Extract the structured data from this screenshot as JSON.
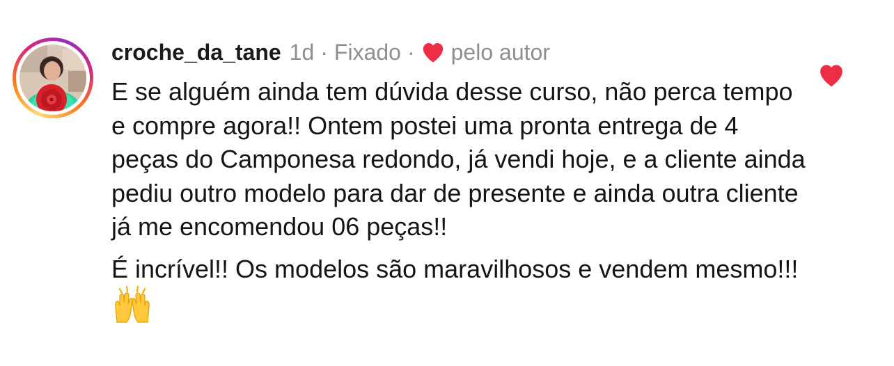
{
  "comment": {
    "username": "croche_da_tane",
    "time": "1d",
    "separator": "·",
    "pinned_label": "Fixado",
    "liked_by_label": "pelo autor",
    "paragraphs": [
      "E se alguém ainda tem dúvida desse curso, não perca tempo e compre agora!! Ontem postei uma pronta entrega de 4 peças do Camponesa redondo, já vendi hoje, e a cliente ainda pediu outro modelo para dar de presente e ainda outra cliente já me encomendou 06 peças!!",
      "É incrível!! Os modelos são maravilhosos e vendem mesmo!!!"
    ],
    "emoji": "raising-hands-emoji",
    "icons": {
      "author_heart": "heart-icon",
      "like": "heart-icon"
    }
  },
  "colors": {
    "heart": "#ed2d43",
    "username": "#1a1a1a",
    "meta": "#8e8e8e",
    "text": "#151515"
  }
}
